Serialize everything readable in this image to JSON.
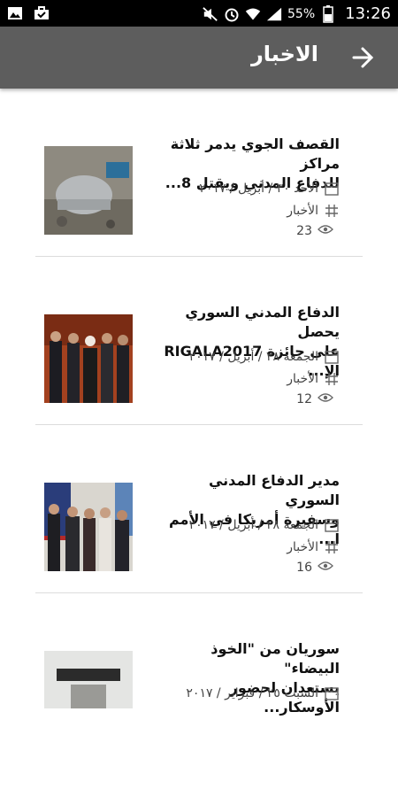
{
  "status": {
    "battery": "55%",
    "time": "13:26"
  },
  "appbar": {
    "title": "الاخبار"
  },
  "items": [
    {
      "title_line1": "القصف الجوي يدمر ثلاثة مراكز",
      "title_line2": "للدفاع المدني ويقتل 8...",
      "date": "الأحد ٣٠ / أبريل / ٢٠١٧",
      "category": "الأخبار",
      "views": "23"
    },
    {
      "title_line1": "الدفاع المدني السوري يحصل",
      "title_line2": "على جائزة RIGALA2017 الإ...",
      "date": "الجمعة ٢٨ / أبريل / ٢٠١٧",
      "category": "الأخبار",
      "views": "12"
    },
    {
      "title_line1": "مدير الدفاع المدني السوري",
      "title_line2": "وسفيرة أمريكا في الأمم ا...",
      "date": "الجمعة ٢٨ / أبريل / ٢٠١٧",
      "category": "الأخبار",
      "views": "16"
    },
    {
      "title_line1": "سوريان من \"الخوذ البيضاء\"",
      "title_line2": "يستعدان لحضور الأوسكار...",
      "date": "السبت ٢٥ / فبراير / ٢٠١٧",
      "category": "",
      "views": ""
    }
  ]
}
